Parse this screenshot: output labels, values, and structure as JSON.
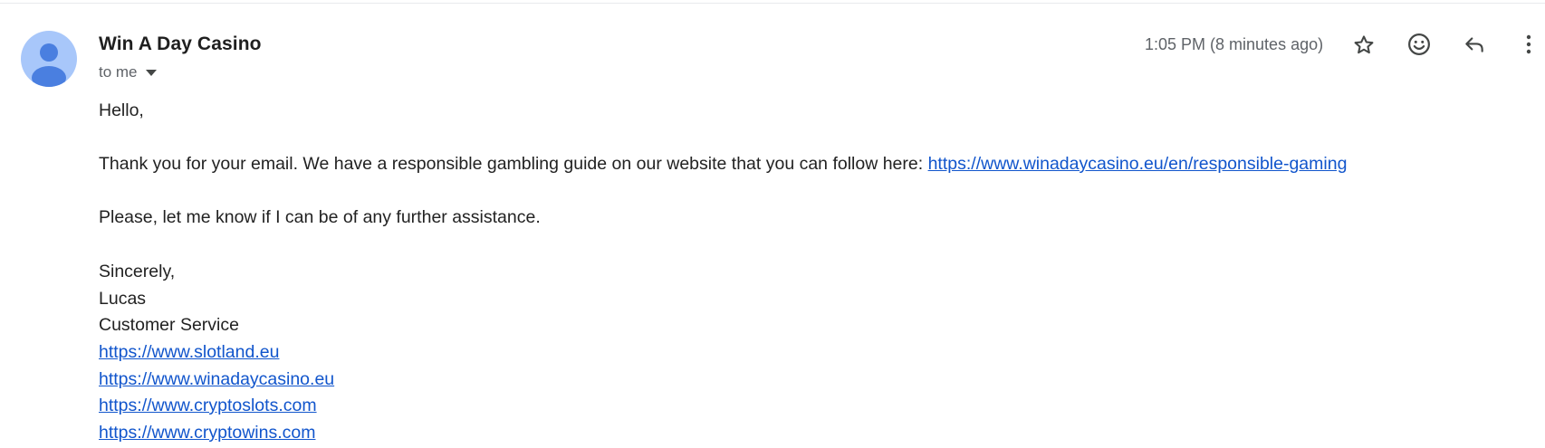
{
  "email": {
    "sender": {
      "name": "Win A Day Casino",
      "avatar_icon": "person-avatar-icon"
    },
    "recipient_label": "to me",
    "timestamp": "1:05 PM (8 minutes ago)",
    "actions": {
      "star_icon": "star-icon",
      "emoji_icon": "emoji-reaction-icon",
      "reply_icon": "reply-icon",
      "more_icon": "more-options-icon"
    },
    "body": {
      "greeting": "Hello,",
      "paragraph1_text": "Thank you for your email. We have a responsible gambling guide on our website that you can follow here: ",
      "paragraph1_link": "https://www.winadaycasino.eu/en/responsible-gaming",
      "paragraph2": "Please, let me know if I can be of any further assistance.",
      "closing": "Sincerely,",
      "signature_name": "Lucas",
      "signature_title": "Customer Service",
      "signature_links": [
        "https://www.slotland.eu",
        "https://www.winadaycasino.eu",
        "https://www.cryptoslots.com",
        "https://www.cryptowins.com"
      ]
    }
  },
  "colors": {
    "link": "#1155cc",
    "avatar_bg": "#a8c7fa",
    "avatar_fg": "#4a7fe0",
    "muted_text": "#5f6368",
    "body_text": "#222222"
  }
}
